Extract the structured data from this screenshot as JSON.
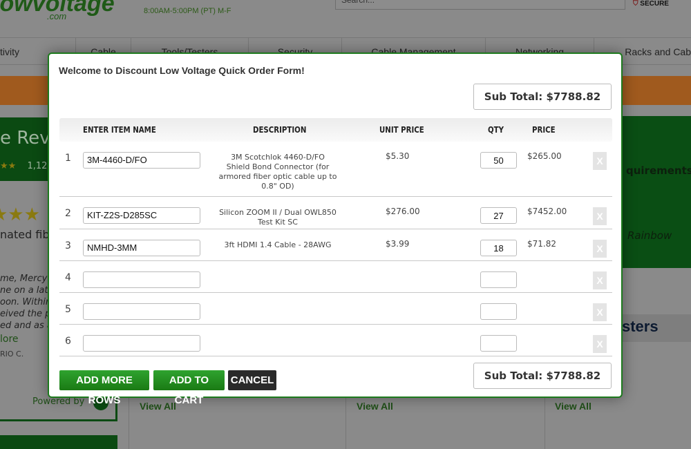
{
  "background": {
    "logo": "lowvoltage",
    "logo_sub": ".com",
    "hours": "8:00AM-5:00PM (PT) M-F",
    "search_placeholder": "Search...",
    "secure": "SECURE",
    "nav": [
      "tivity",
      "Cable",
      "Tools/Testers",
      "Security",
      "Cable Management",
      "Networking",
      "Racks and Cab"
    ],
    "reviews_heading": "e Revie",
    "review_count": "1,12",
    "review_title": "nated fibe",
    "review_lines": [
      "me, Mercy",
      "ne on a late",
      "oon. Within",
      "eived the p",
      "ed and as a"
    ],
    "read_more": "lore",
    "reviewer": "RIO C.",
    "powered_by": "Powered by",
    "right_heading": "quirements",
    "right_italic": "Rainbow",
    "testers_heading": "sters",
    "view_all": "View All"
  },
  "modal": {
    "title": "Welcome to Discount Low Voltage Quick Order Form!",
    "subtotal": "Sub Total: $7788.82",
    "headers": {
      "item": "ENTER ITEM NAME",
      "description": "DESCRIPTION",
      "unit_price": "UNIT PRICE",
      "qty": "QTY",
      "price": "PRICE"
    },
    "rows": [
      {
        "num": "1",
        "item": "3M-4460-D/FO",
        "description": "3M Scotchlok 4460-D/FO Shield Bond Connector (for armored fiber optic cable up to 0.8\" OD)",
        "unit_price": "$5.30",
        "qty": "50",
        "price": "$265.00"
      },
      {
        "num": "2",
        "item": "KIT-Z2S-D285SC",
        "description": "Silicon ZOOM II / Dual OWL850 Test Kit SC",
        "unit_price": "$276.00",
        "qty": "27",
        "price": "$7452.00"
      },
      {
        "num": "3",
        "item": "NMHD-3MM",
        "description": "3ft HDMI 1.4 Cable - 28AWG",
        "unit_price": "$3.99",
        "qty": "18",
        "price": "$71.82"
      },
      {
        "num": "4",
        "item": "",
        "description": "",
        "unit_price": "",
        "qty": "",
        "price": ""
      },
      {
        "num": "5",
        "item": "",
        "description": "",
        "unit_price": "",
        "qty": "",
        "price": ""
      },
      {
        "num": "6",
        "item": "",
        "description": "",
        "unit_price": "",
        "qty": "",
        "price": ""
      }
    ],
    "remove_label": "X",
    "buttons": {
      "add_rows": "ADD MORE ROWS",
      "add_cart": "ADD TO CART",
      "cancel": "CANCEL"
    },
    "accent": "#1d7a1d"
  }
}
